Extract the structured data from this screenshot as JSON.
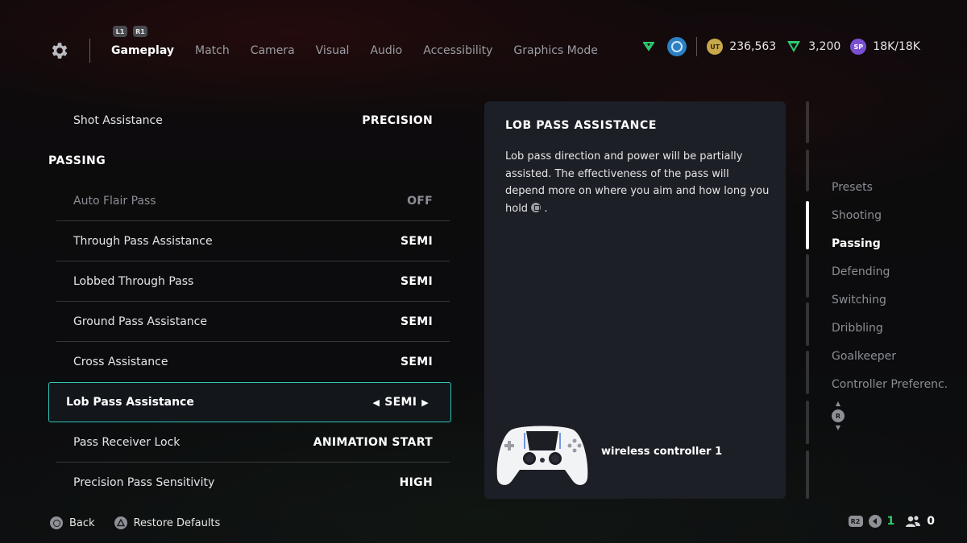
{
  "header": {
    "bumper_left": "L1",
    "bumper_right": "R1",
    "tabs": [
      {
        "label": "Gameplay",
        "active": true
      },
      {
        "label": "Match",
        "active": false
      },
      {
        "label": "Camera",
        "active": false
      },
      {
        "label": "Visual",
        "active": false
      },
      {
        "label": "Audio",
        "active": false
      },
      {
        "label": "Accessibility",
        "active": false
      },
      {
        "label": "Graphics Mode",
        "active": false
      }
    ],
    "currency": {
      "coins": "236,563",
      "points": "3,200",
      "sp_badge": "SP",
      "sp": "18K/18K",
      "coin_badge": "UT",
      "colors": {
        "coins": "#c9a84a",
        "points": "#2ecc71",
        "sp": "#7b4fd1",
        "club": "#2b7fc4"
      }
    }
  },
  "settings": {
    "shot_assistance": {
      "label": "Shot Assistance",
      "value": "PRECISION"
    },
    "section_title": "PASSING",
    "rows": [
      {
        "label": "Auto Flair Pass",
        "value": "OFF"
      },
      {
        "label": "Through Pass Assistance",
        "value": "SEMI"
      },
      {
        "label": "Lobbed Through Pass",
        "value": "SEMI"
      },
      {
        "label": "Ground Pass Assistance",
        "value": "SEMI"
      },
      {
        "label": "Cross Assistance",
        "value": "SEMI"
      },
      {
        "label": "Lob Pass Assistance",
        "value": "SEMI"
      },
      {
        "label": "Pass Receiver Lock",
        "value": "ANIMATION START"
      },
      {
        "label": "Precision Pass Sensitivity",
        "value": "HIGH"
      }
    ],
    "arrow_left": "◀",
    "arrow_right": "▶"
  },
  "info_panel": {
    "title": "LOB PASS ASSISTANCE",
    "description": "Lob pass direction and power will be partially assisted. The effectiveness of the pass will depend more on where you aim and how long you hold",
    "description_end": ".",
    "controller_label": "wireless controller 1"
  },
  "right_nav": {
    "items": [
      {
        "label": "Presets",
        "active": false
      },
      {
        "label": "Shooting",
        "active": false
      },
      {
        "label": "Passing",
        "active": true
      },
      {
        "label": "Defending",
        "active": false
      },
      {
        "label": "Switching",
        "active": false
      },
      {
        "label": "Dribbling",
        "active": false
      },
      {
        "label": "Goalkeeper",
        "active": false
      },
      {
        "label": "Controller Preferenc...",
        "active": false
      }
    ],
    "stick_label": "R"
  },
  "footer": {
    "back_label": "Back",
    "restore_label": "Restore Defaults",
    "r2_label": "R2",
    "online_count": "1",
    "friends_count": "0",
    "accent": "#2ec4b6"
  }
}
